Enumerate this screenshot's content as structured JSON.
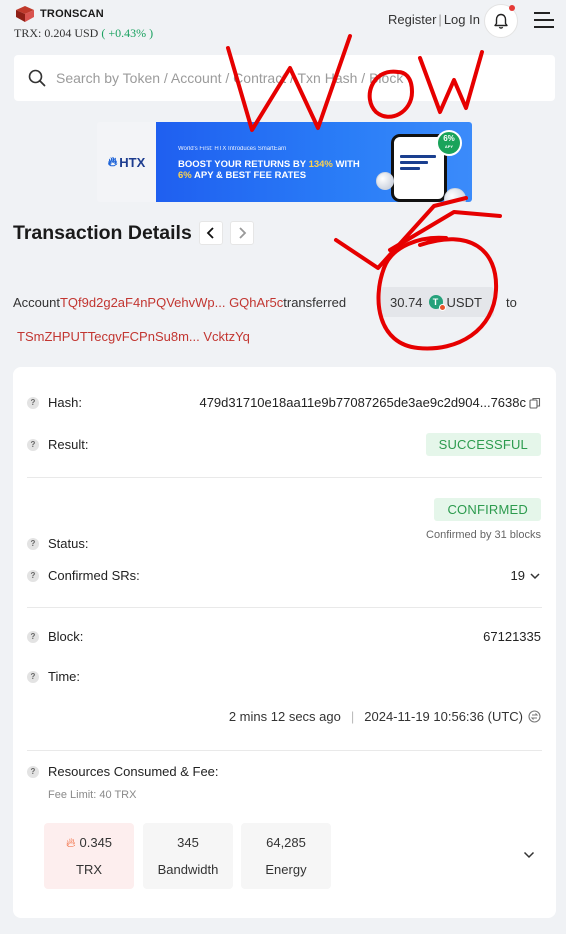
{
  "header": {
    "brand": "TRONSCAN",
    "price": "TRX: 0.204 USD",
    "change": "( +0.43% )",
    "register": "Register",
    "login": "Log In",
    "separator": "|"
  },
  "search": {
    "placeholder": "Search by Token / Account / Contract / Txn Hash / Block"
  },
  "banner": {
    "brand": "HTX",
    "small": "World's First: HTX Introduces SmartEarn",
    "line1_a": "BOOST YOUR RETURNS BY ",
    "line1_hl": "134%",
    "line1_b": " WITH",
    "line2_hl": "6%",
    "line2_b": " APY & BEST FEE RATES",
    "apy_value": "6%",
    "apy_label": "APY"
  },
  "page": {
    "title": "Transaction Details"
  },
  "transfer": {
    "account_word": "Account",
    "from_address": "TQf9d2g2aF4nPQVehvWp... GQhAr5c",
    "transferred_word": "transferred",
    "amount": "30.74",
    "token": "USDT",
    "to_word": "to",
    "to_address": "TSmZHPUTTecgvFCPnSu8m... VcktzYq"
  },
  "details": {
    "hash_label": "Hash:",
    "hash_value": "479d31710e18aa11e9b77087265de3ae9c2d904...7638c",
    "result_label": "Result:",
    "result_value": "SUCCESSFUL",
    "status_label": "Status:",
    "status_value": "CONFIRMED",
    "status_note": "Confirmed by 31 blocks",
    "srs_label": "Confirmed SRs:",
    "srs_value": "19",
    "block_label": "Block:",
    "block_value": "67121335",
    "time_label": "Time:",
    "time_ago": "2 mins 12 secs ago",
    "time_sep": "|",
    "time_value": "2024-11-19 10:56:36 (UTC)",
    "resources_label": "Resources Consumed & Fee:",
    "fee_limit": "Fee Limit: 40 TRX",
    "trx_value": "0.345",
    "trx_unit": "TRX",
    "bandwidth_value": "345",
    "bandwidth_unit": "Bandwidth",
    "energy_value": "64,285",
    "energy_unit": "Energy"
  },
  "overlay": {
    "handwriting": "WoW"
  },
  "colors": {
    "accent_red": "#c23631",
    "success_green": "#2c9b4e",
    "success_bg": "#e5f6ea",
    "banner_blue": "#2a7df7",
    "ink_red": "#e60000"
  }
}
